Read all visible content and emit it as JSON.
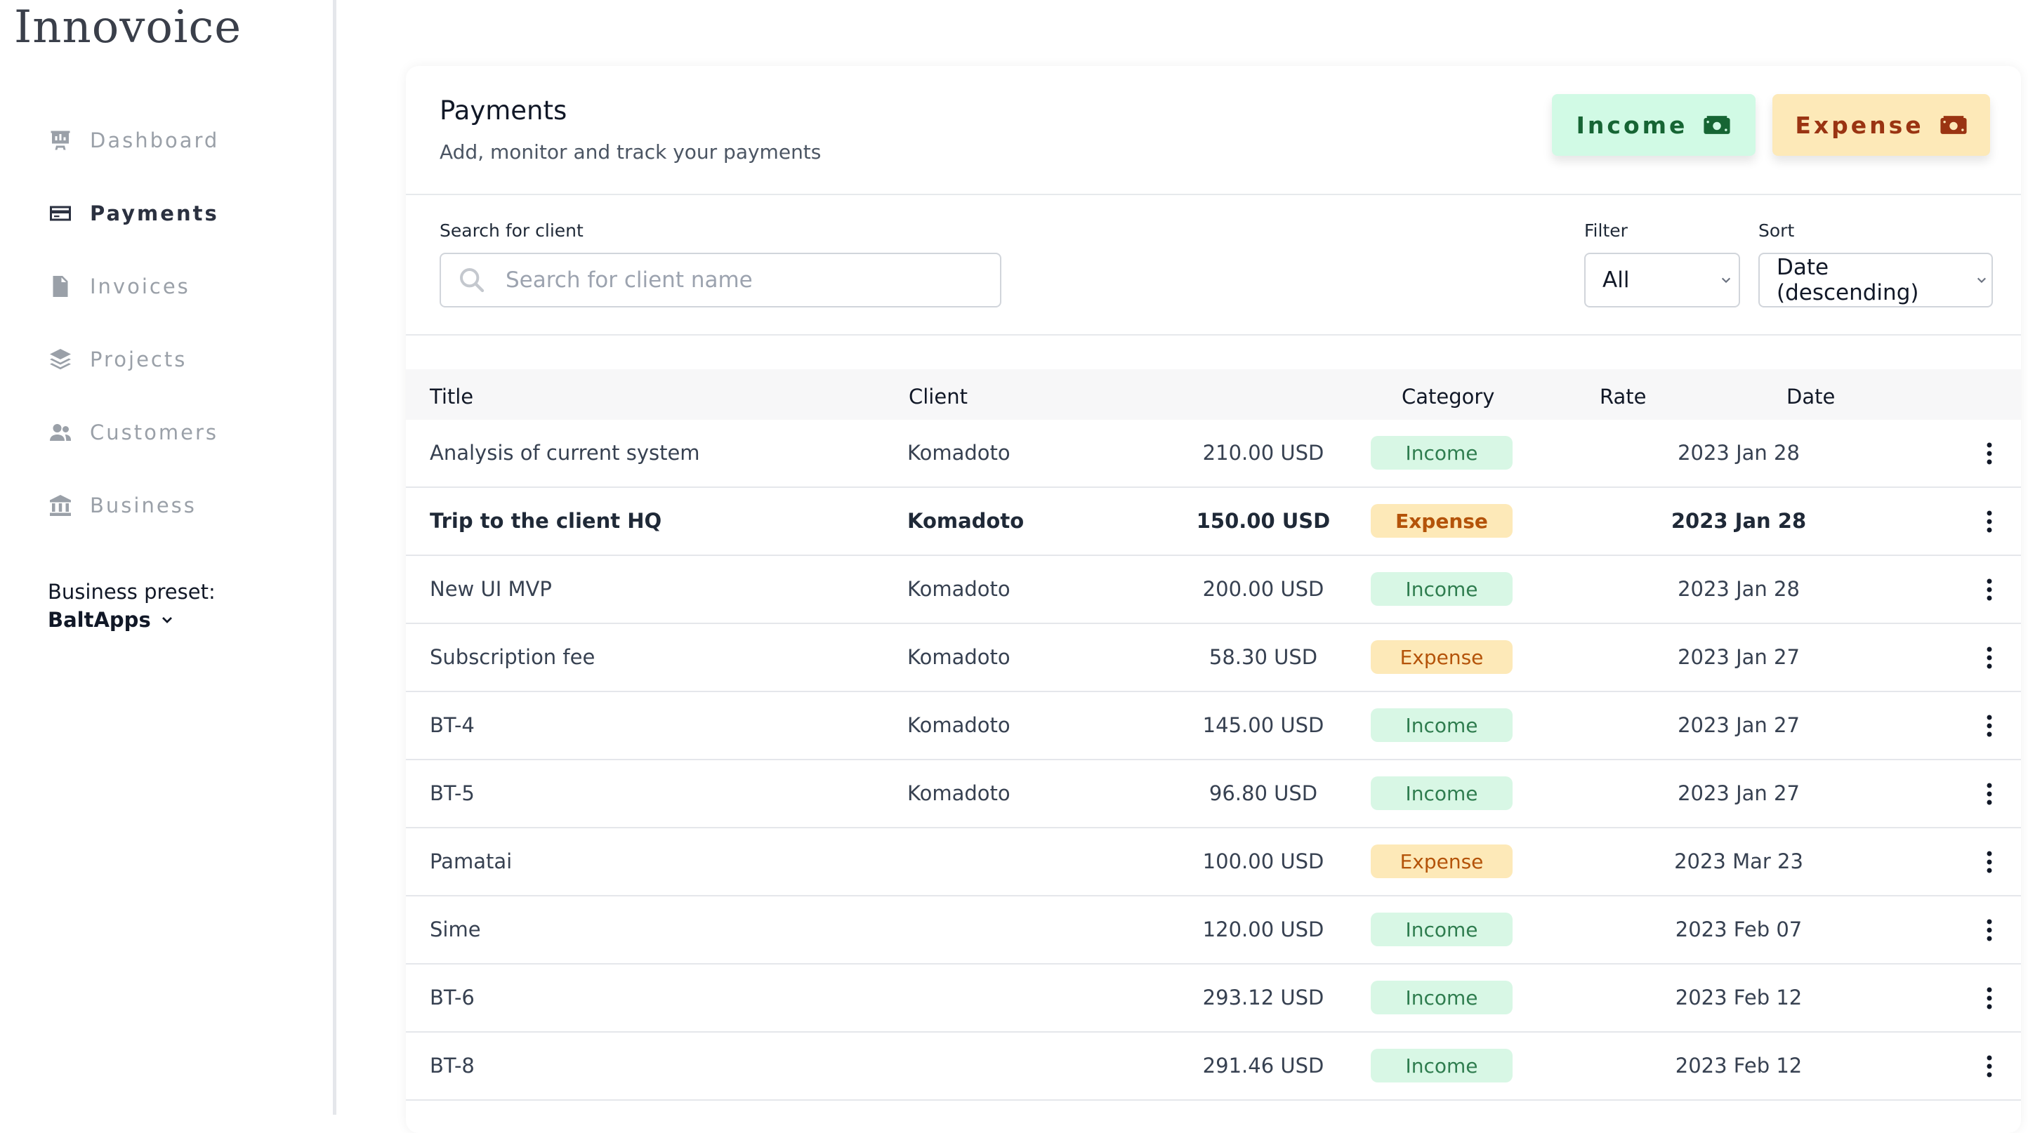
{
  "app": {
    "logo": "Innovoice"
  },
  "sidebar": {
    "items": [
      {
        "label": "Dashboard",
        "icon": "dashboard-icon",
        "active": false
      },
      {
        "label": "Payments",
        "icon": "credit-card-icon",
        "active": true
      },
      {
        "label": "Invoices",
        "icon": "document-icon",
        "active": false
      },
      {
        "label": "Projects",
        "icon": "layers-icon",
        "active": false
      },
      {
        "label": "Customers",
        "icon": "users-icon",
        "active": false
      },
      {
        "label": "Business",
        "icon": "bank-icon",
        "active": false
      }
    ],
    "preset": {
      "label": "Business preset:",
      "value": "BaltApps"
    }
  },
  "header": {
    "title": "Payments",
    "subtitle": "Add, monitor and track your payments",
    "income_label": "Income",
    "expense_label": "Expense"
  },
  "search": {
    "label": "Search for client",
    "placeholder": "Search for client name"
  },
  "filter": {
    "label": "Filter",
    "value": "All"
  },
  "sort": {
    "label": "Sort",
    "value": "Date (descending)"
  },
  "table": {
    "columns": {
      "title": "Title",
      "client": "Client",
      "category": "Category",
      "rate": "Rate",
      "date": "Date"
    },
    "rows": [
      {
        "title": "Analysis of current system",
        "client": "Komadoto",
        "category": "Income",
        "rate": "210.00 USD",
        "date": "2023 Jan 28"
      },
      {
        "title": "Trip to the client HQ",
        "client": "Komadoto",
        "category": "Expense",
        "rate": "150.00 USD",
        "date": "2023 Jan 28"
      },
      {
        "title": "New UI MVP",
        "client": "Komadoto",
        "category": "Income",
        "rate": "200.00 USD",
        "date": "2023 Jan 28"
      },
      {
        "title": "Subscription fee",
        "client": "Komadoto",
        "category": "Expense",
        "rate": "58.30 USD",
        "date": "2023 Jan 27"
      },
      {
        "title": "BT-4",
        "client": "Komadoto",
        "category": "Income",
        "rate": "145.00 USD",
        "date": "2023 Jan 27"
      },
      {
        "title": "BT-5",
        "client": "Komadoto",
        "category": "Income",
        "rate": "96.80 USD",
        "date": "2023 Jan 27"
      },
      {
        "title": "Pamatai",
        "client": "",
        "category": "Expense",
        "rate": "100.00 USD",
        "date": "2023 Mar 23"
      },
      {
        "title": "Sime",
        "client": "",
        "category": "Income",
        "rate": "120.00 USD",
        "date": "2023 Feb 07"
      },
      {
        "title": "BT-6",
        "client": "",
        "category": "Income",
        "rate": "293.12 USD",
        "date": "2023 Feb 12"
      },
      {
        "title": "BT-8",
        "client": "",
        "category": "Income",
        "rate": "291.46 USD",
        "date": "2023 Feb 12"
      }
    ]
  },
  "colors": {
    "income_bg": "#d8f7e5",
    "income_text": "#2f7d4f",
    "expense_bg": "#fde9b8",
    "expense_text": "#b45309"
  }
}
